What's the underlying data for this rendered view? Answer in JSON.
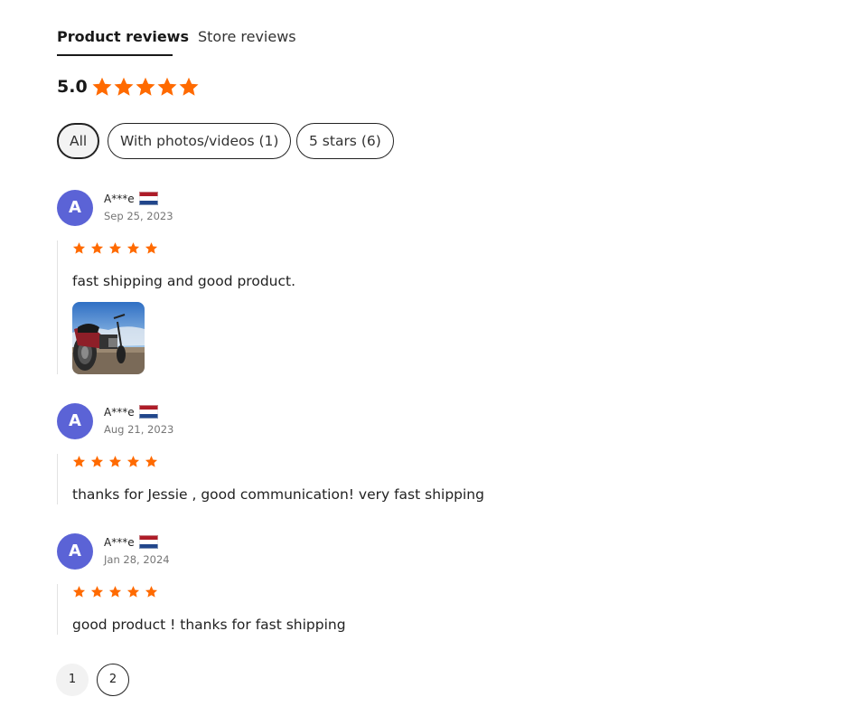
{
  "tabs": {
    "product_reviews": "Product reviews",
    "store_reviews": "Store reviews"
  },
  "summary": {
    "rating": "5.0",
    "stars": 5
  },
  "filters": [
    {
      "label": "All",
      "selected": true
    },
    {
      "label": "With photos/videos (1)",
      "selected": false
    },
    {
      "label": "5 stars (6)",
      "selected": false
    }
  ],
  "colors": {
    "star": "#ff6a00",
    "avatar": "#5b63d6"
  },
  "reviews": [
    {
      "avatar_initial": "A",
      "user": "A***e",
      "country_flag": "netherlands-flag-icon",
      "date": "Sep 25, 2023",
      "stars": 5,
      "text": "fast shipping and good product.",
      "has_photo": true
    },
    {
      "avatar_initial": "A",
      "user": "A***e",
      "country_flag": "netherlands-flag-icon",
      "date": "Aug 21, 2023",
      "stars": 5,
      "text": "thanks for Jessie , good communication! very fast shipping",
      "has_photo": false
    },
    {
      "avatar_initial": "A",
      "user": "A***e",
      "country_flag": "netherlands-flag-icon",
      "date": "Jan 28, 2024",
      "stars": 5,
      "text": "good product ! thanks for fast shipping",
      "has_photo": false
    }
  ],
  "pagination": {
    "pages": [
      "1",
      "2"
    ],
    "current": "2"
  }
}
